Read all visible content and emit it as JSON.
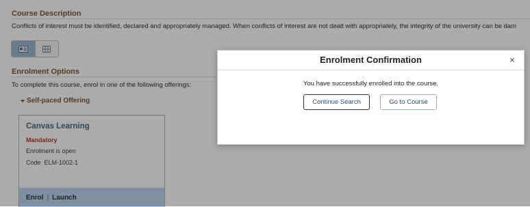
{
  "course_description": {
    "title": "Course Description",
    "text": "Conflicts of interest must be identified, declared and appropriately managed. When conflicts of interest are not dealt with appropriately, the integrity of the university can be dam"
  },
  "view_toggle": {
    "options": [
      "card-view-icon",
      "grid-view-icon"
    ],
    "active": "card-view-icon"
  },
  "enrolment_options": {
    "title": "Enrolment Options",
    "instruction": "To complete this course, enrol in one of the following offerings:",
    "offering_label": "Self-paced Offering"
  },
  "card": {
    "title": "Canvas Learning",
    "mandatory": "Mandatory",
    "status": "Enrolment is open",
    "code_label": "Code",
    "code_value": "ELM-1002-1",
    "action_enrol": "Enrol",
    "action_separator": "|",
    "action_launch": "Launch"
  },
  "modal": {
    "title": "Enrolment Confirmation",
    "close_symbol": "×",
    "message": "You have successfully enrolled into the course.",
    "continue_label": "Continue Search",
    "go_label": "Go to Course"
  },
  "colors": {
    "section_title": "#7d5a35",
    "mandatory": "#c0392b",
    "card_title": "#4a6a8a",
    "card_footer": "#bed6ef",
    "button_text": "#2a4f77"
  }
}
